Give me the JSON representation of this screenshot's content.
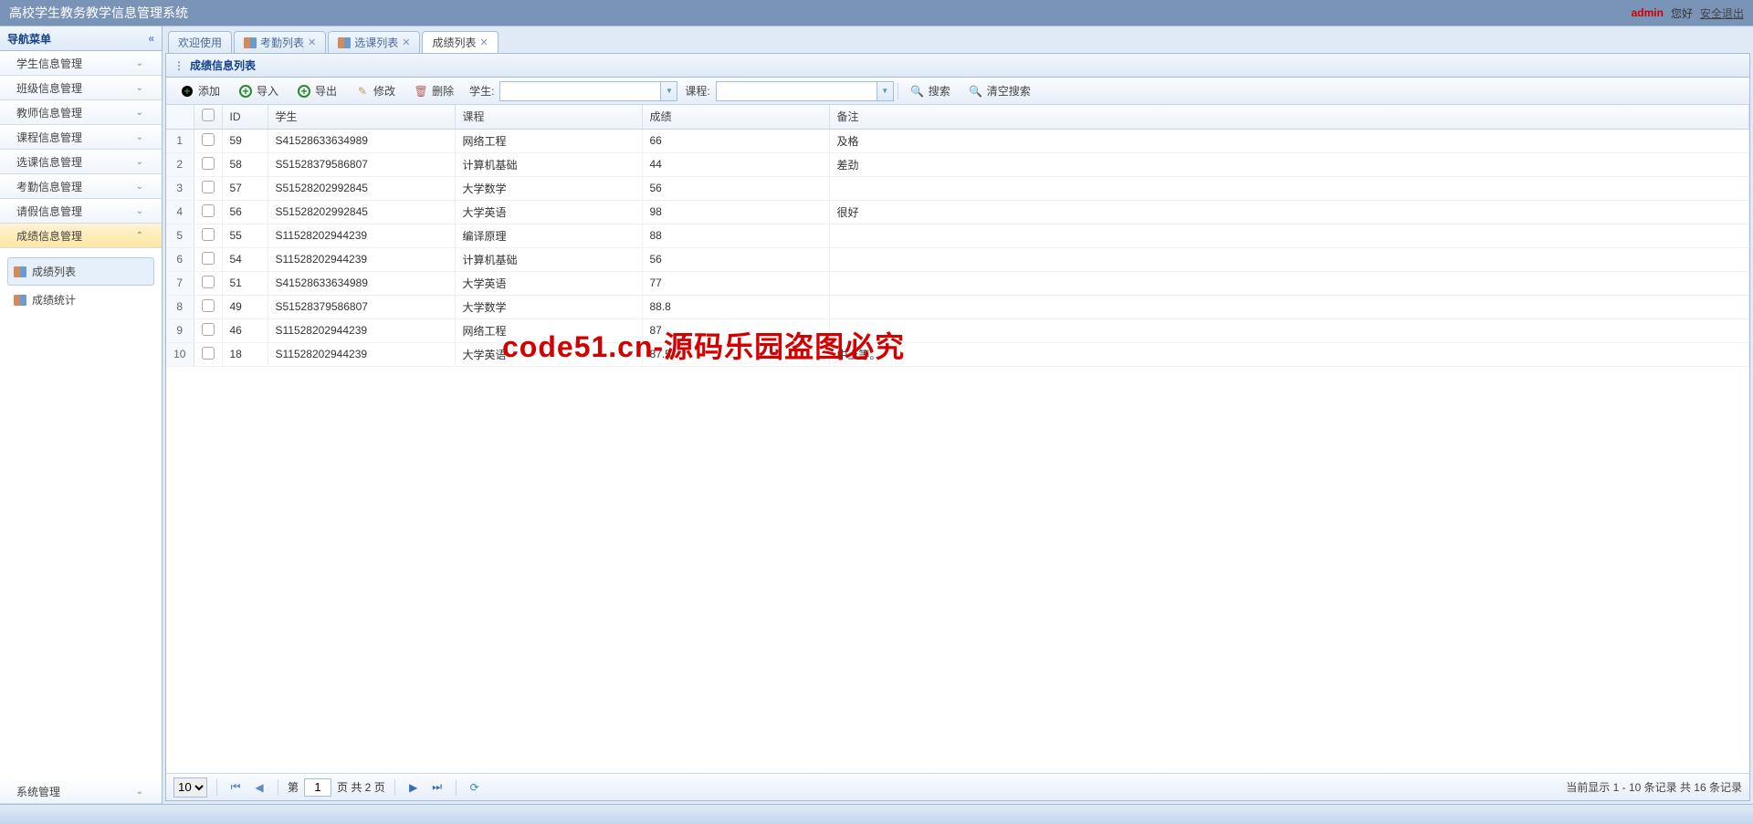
{
  "header": {
    "title": "高校学生教务教学信息管理系统",
    "user": "admin",
    "greet": "您好",
    "logout": "安全退出"
  },
  "sidebar": {
    "title": "导航菜单",
    "items": [
      {
        "label": "学生信息管理",
        "active": false
      },
      {
        "label": "班级信息管理",
        "active": false
      },
      {
        "label": "教师信息管理",
        "active": false
      },
      {
        "label": "课程信息管理",
        "active": false
      },
      {
        "label": "选课信息管理",
        "active": false
      },
      {
        "label": "考勤信息管理",
        "active": false
      },
      {
        "label": "请假信息管理",
        "active": false
      },
      {
        "label": "成绩信息管理",
        "active": true
      }
    ],
    "subItems": [
      {
        "label": "成绩列表",
        "active": true
      },
      {
        "label": "成绩统计",
        "active": false
      }
    ],
    "footer": "系统管理"
  },
  "tabs": [
    {
      "label": "欢迎使用",
      "icon": false,
      "closable": false,
      "active": false
    },
    {
      "label": "考勤列表",
      "icon": true,
      "closable": true,
      "active": false
    },
    {
      "label": "选课列表",
      "icon": true,
      "closable": true,
      "active": false
    },
    {
      "label": "成绩列表",
      "icon": false,
      "closable": true,
      "active": true
    }
  ],
  "panel": {
    "title": "成绩信息列表"
  },
  "toolbar": {
    "add": "添加",
    "import": "导入",
    "export": "导出",
    "edit": "修改",
    "delete": "删除",
    "studentLabel": "学生:",
    "courseLabel": "课程:",
    "search": "搜索",
    "clear": "清空搜索"
  },
  "columns": [
    "",
    "",
    "ID",
    "学生",
    "课程",
    "成绩",
    "备注"
  ],
  "rows": [
    {
      "n": "1",
      "id": "59",
      "student": "S41528633634989",
      "course": "网络工程",
      "score": "66",
      "remark": "及格"
    },
    {
      "n": "2",
      "id": "58",
      "student": "S51528379586807",
      "course": "计算机基础",
      "score": "44",
      "remark": "差劲"
    },
    {
      "n": "3",
      "id": "57",
      "student": "S51528202992845",
      "course": "大学数学",
      "score": "56",
      "remark": ""
    },
    {
      "n": "4",
      "id": "56",
      "student": "S51528202992845",
      "course": "大学英语",
      "score": "98",
      "remark": "很好"
    },
    {
      "n": "5",
      "id": "55",
      "student": "S11528202944239",
      "course": "编译原理",
      "score": "88",
      "remark": ""
    },
    {
      "n": "6",
      "id": "54",
      "student": "S11528202944239",
      "course": "计算机基础",
      "score": "56",
      "remark": ""
    },
    {
      "n": "7",
      "id": "51",
      "student": "S41528633634989",
      "course": "大学英语",
      "score": "77",
      "remark": ""
    },
    {
      "n": "8",
      "id": "49",
      "student": "S51528379586807",
      "course": "大学数学",
      "score": "88.8",
      "remark": ""
    },
    {
      "n": "9",
      "id": "46",
      "student": "S11528202944239",
      "course": "网络工程",
      "score": "87",
      "remark": ""
    },
    {
      "n": "10",
      "id": "18",
      "student": "S11528202944239",
      "course": "大学英语",
      "score": "87.5",
      "remark": "中上等。"
    }
  ],
  "pager": {
    "pageSize": "10",
    "pageLabel1": "第",
    "currentPage": "1",
    "pageLabel2": "页 共 2 页",
    "info": "当前显示 1 - 10 条记录 共 16 条记录"
  },
  "watermark": "code51.cn-源码乐园盗图必究"
}
